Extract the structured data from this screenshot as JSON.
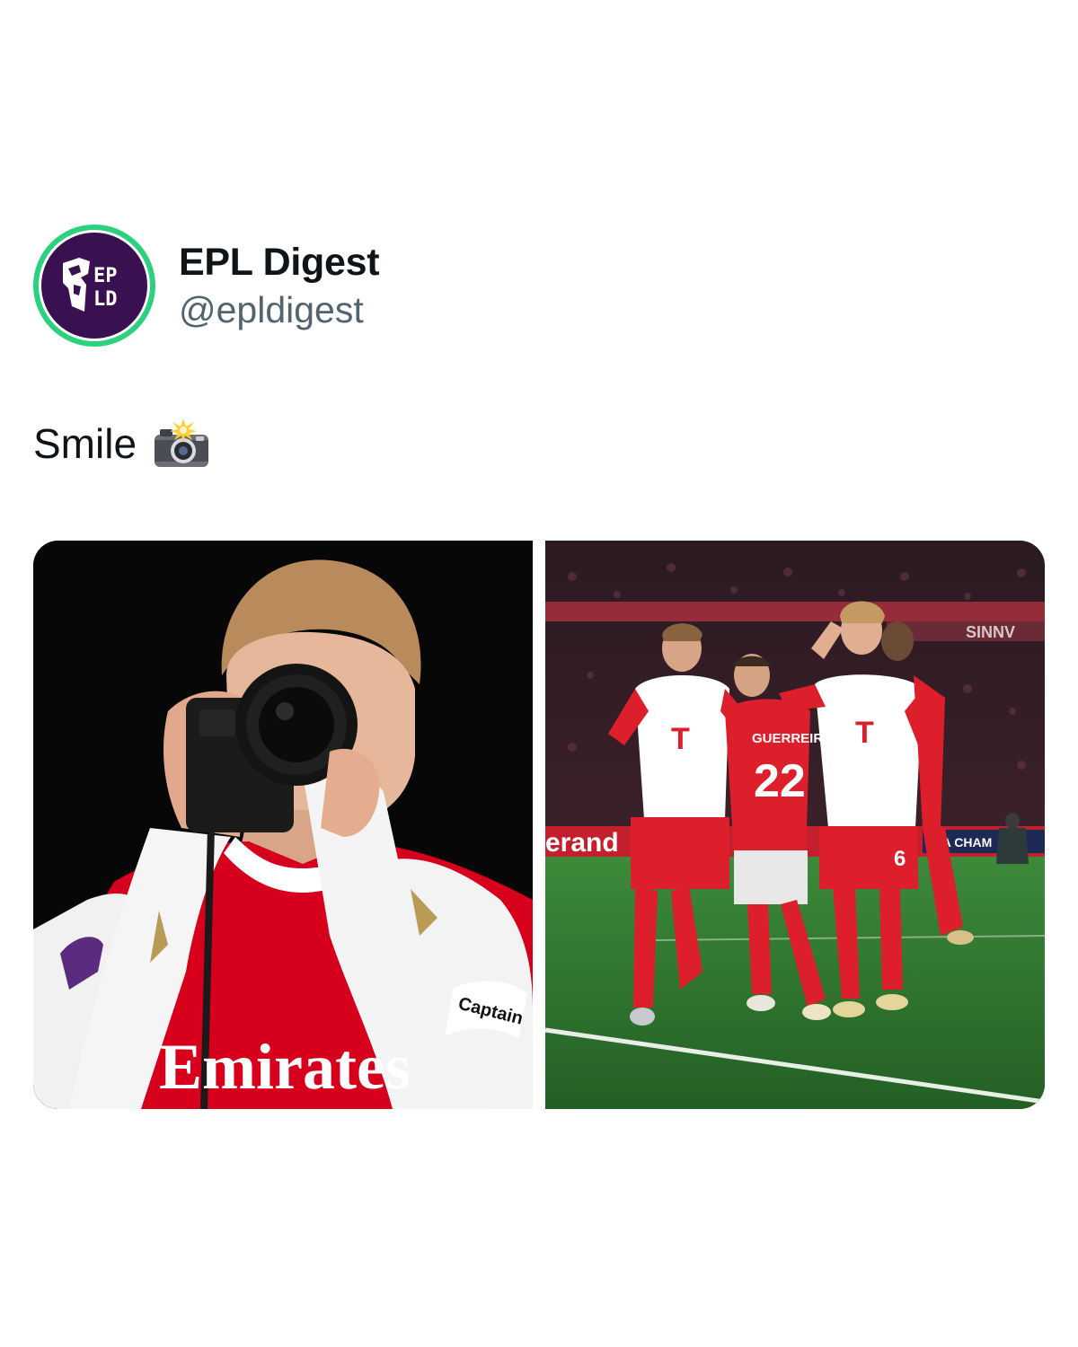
{
  "account": {
    "display_name": "EPL Digest",
    "handle": "@epldigest",
    "avatar_logo_text": [
      "EP",
      "LD"
    ]
  },
  "post": {
    "text": "Smile",
    "emoji_icon": "camera-with-flash-icon"
  },
  "media": {
    "left_photo": {
      "description_icon": "player-photographing-icon",
      "shirt_sponsor": "Emirates",
      "armband": "Captain"
    },
    "right_photo": {
      "description_icon": "team-celebration-icon",
      "ad_board": "erand",
      "ad_board_right": "SINNV",
      "ad_board_far": "FA CHAM",
      "player_number": "6",
      "back_name": "GUERREIRO",
      "back_number": "22"
    }
  },
  "colors": {
    "avatar_ring": "#2bd17e",
    "avatar_fill": "#3a1150",
    "arsenal_red": "#d6001c",
    "bayern_red": "#dc1f2a",
    "pitch_green": "#2e7a2e",
    "handle_gray": "#536471"
  }
}
